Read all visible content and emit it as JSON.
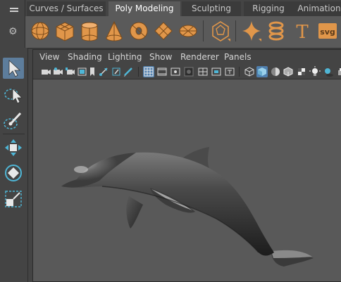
{
  "shelf": {
    "tabs": [
      {
        "label": "Curves / Surfaces",
        "active": false
      },
      {
        "label": "Poly Modeling",
        "active": true
      },
      {
        "label": "Sculpting",
        "active": false
      },
      {
        "label": "Rigging",
        "active": false
      },
      {
        "label": "Animation",
        "active": false
      }
    ],
    "icons": [
      {
        "name": "poly-sphere-icon"
      },
      {
        "name": "poly-cube-icon"
      },
      {
        "name": "poly-cylinder-icon"
      },
      {
        "name": "poly-cone-icon"
      },
      {
        "name": "poly-torus-icon"
      },
      {
        "name": "poly-plane-icon"
      },
      {
        "name": "poly-disc-icon"
      },
      {
        "name": "platonic-solid-icon"
      },
      {
        "name": "super-shape-icon"
      },
      {
        "name": "poly-helix-icon"
      },
      {
        "name": "type-text-icon",
        "glyph": "T"
      },
      {
        "name": "svg-icon",
        "text": "svg"
      }
    ],
    "accent_color": "#e0964a"
  },
  "panel": {
    "menus": [
      "View",
      "Shading",
      "Lighting",
      "Show",
      "Renderer",
      "Panels"
    ]
  },
  "toolbox": {
    "tools": [
      {
        "name": "select-tool-icon",
        "active": true
      },
      {
        "name": "lasso-select-icon",
        "active": false
      },
      {
        "name": "paint-select-icon",
        "active": false
      },
      {
        "name": "move-tool-icon",
        "active": false
      },
      {
        "name": "rotate-tool-icon",
        "active": false
      },
      {
        "name": "scale-tool-icon",
        "active": false
      }
    ],
    "active_color": "#5d7d9c"
  },
  "viewport": {
    "background_color": "#595959",
    "object": "dolphin-model"
  }
}
